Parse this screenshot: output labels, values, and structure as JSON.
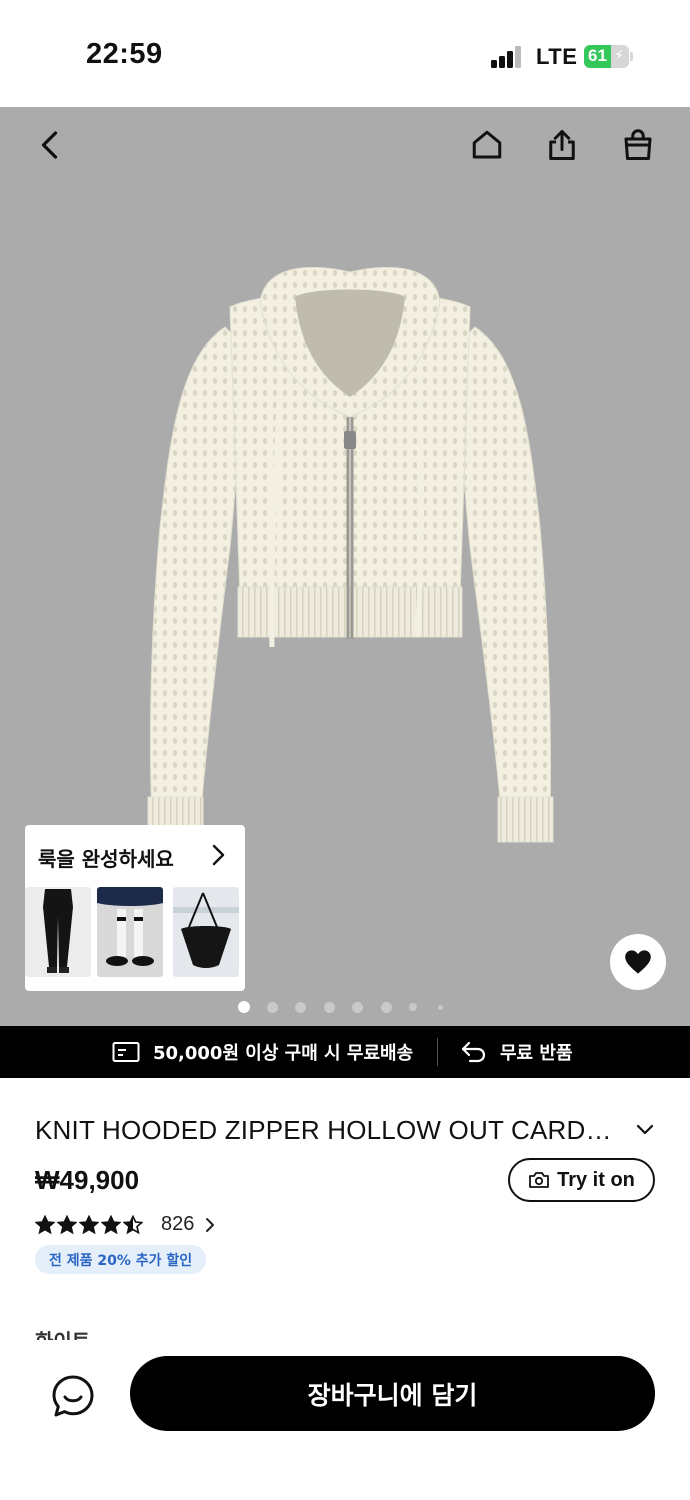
{
  "status_bar": {
    "time": "22:59",
    "network": "LTE",
    "battery": "61",
    "battery_level": 0.61
  },
  "nav": {
    "back_icon": "chevron-left-icon",
    "home_icon": "home-icon",
    "share_icon": "share-icon",
    "bag_icon": "shopping-bag-icon"
  },
  "look_card": {
    "title": "룩을 완성하세요",
    "items": [
      "black-wide-pants",
      "knee-socks-mary-janes",
      "black-hobo-bag"
    ]
  },
  "gallery": {
    "current_index": 0,
    "dot_count": 8
  },
  "shipping": {
    "free_shipping": "50,000원 이상 구매 시 무료배송",
    "free_return": "무료 반품"
  },
  "product": {
    "title": "KNIT HOODED ZIPPER HOLLOW OUT CARDIGAN",
    "price": "₩49,900",
    "try_on_label": "Try it on",
    "rating": 4.5,
    "review_count": "826",
    "promo": "전 제품 20% 추가 할인",
    "color_label": "화이트"
  },
  "bottom_bar": {
    "cart_label": "장바구니에 담기"
  },
  "colors": {
    "hero_bg": "#ababab",
    "banner_bg": "#000000",
    "promo_bg": "#e5effa",
    "promo_text": "#2a66c4",
    "battery_green": "#34c759"
  }
}
